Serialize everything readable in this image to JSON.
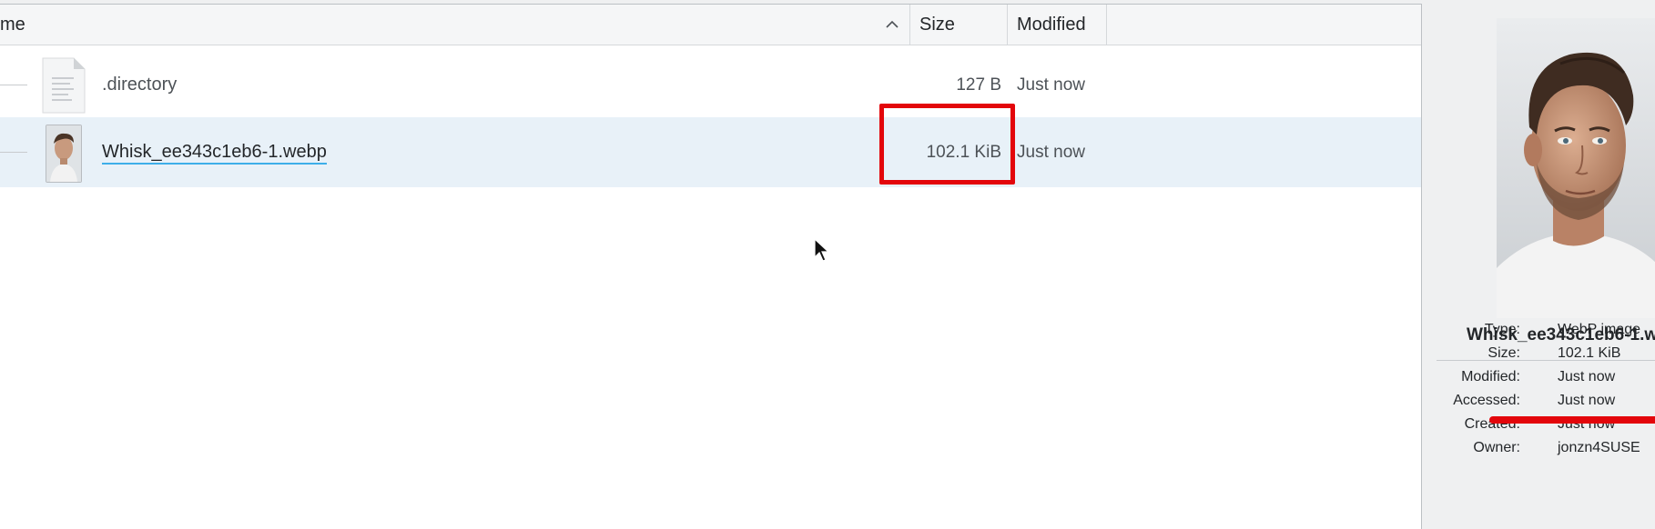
{
  "header": {
    "name_label": "me",
    "size_label": "Size",
    "modified_label": "Modified"
  },
  "files": [
    {
      "name": ".directory",
      "size": "127 B",
      "modified": "Just now",
      "icon": "text-file-icon"
    },
    {
      "name": "Whisk_ee343c1eb6-1.webp",
      "size": "102.1 KiB",
      "modified": "Just now",
      "icon": "image-thumbnail"
    }
  ],
  "info_panel": {
    "filename": "Whisk_ee343c1eb6-1.w",
    "properties": [
      {
        "key": "Type:",
        "value": "WebP image"
      },
      {
        "key": "Size:",
        "value": "102.1 KiB"
      },
      {
        "key": "Modified:",
        "value": "Just now"
      },
      {
        "key": "Accessed:",
        "value": "Just now"
      },
      {
        "key": "Created:",
        "value": "Just now"
      },
      {
        "key": "Owner:",
        "value": "jonzn4SUSE"
      }
    ]
  },
  "colors": {
    "annotation_red": "#e3060b",
    "selection_blue": "#3daee9"
  }
}
